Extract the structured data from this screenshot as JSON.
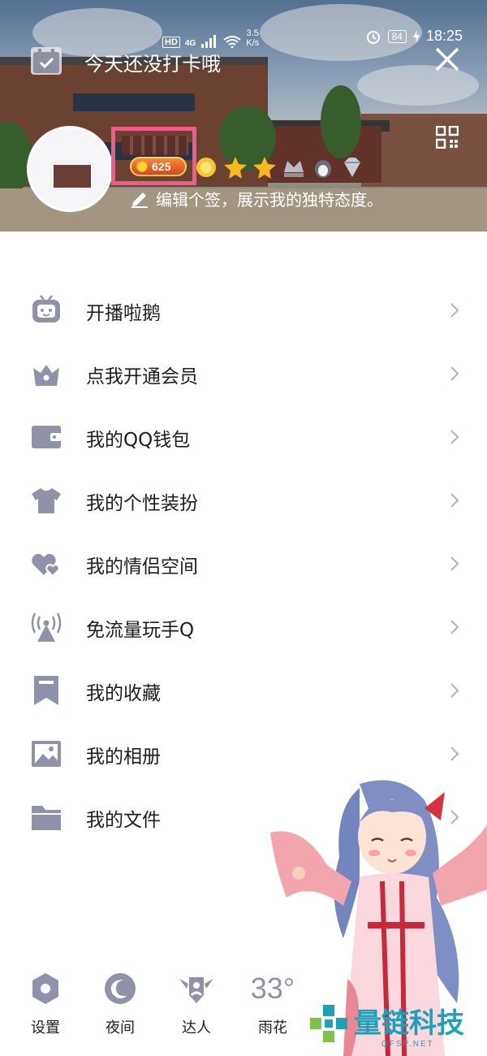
{
  "status_bar": {
    "network_type": "HD",
    "signal": "4G",
    "speed_value": "3.5",
    "speed_unit": "K/s",
    "battery": "84",
    "time": "18:25"
  },
  "header": {
    "checkin_text": "今天还没打卡哦",
    "coin_count": "625",
    "signature": "编辑个签，展示我的独特态度。",
    "highlight_color": "#ee5c8a"
  },
  "menu": {
    "items": [
      {
        "label": "开播啦鹅",
        "icon": "tv-mascot-icon"
      },
      {
        "label": "点我开通会员",
        "icon": "crown-icon"
      },
      {
        "label": "我的QQ钱包",
        "icon": "wallet-icon"
      },
      {
        "label": "我的个性装扮",
        "icon": "tshirt-icon"
      },
      {
        "label": "我的情侣空间",
        "icon": "hearts-icon"
      },
      {
        "label": "免流量玩手Q",
        "icon": "antenna-icon"
      },
      {
        "label": "我的收藏",
        "icon": "bookmark-icon"
      },
      {
        "label": "我的相册",
        "icon": "photo-icon"
      },
      {
        "label": "我的文件",
        "icon": "folder-icon"
      }
    ],
    "icon_color": "#8f92a8"
  },
  "bottom_bar": {
    "settings": "设置",
    "night": "夜间",
    "expert": "达人",
    "weather_temp": "33°",
    "weather_city": "雨花"
  },
  "watermark": {
    "text": "量链科技",
    "sub": "QFSP.NET"
  }
}
